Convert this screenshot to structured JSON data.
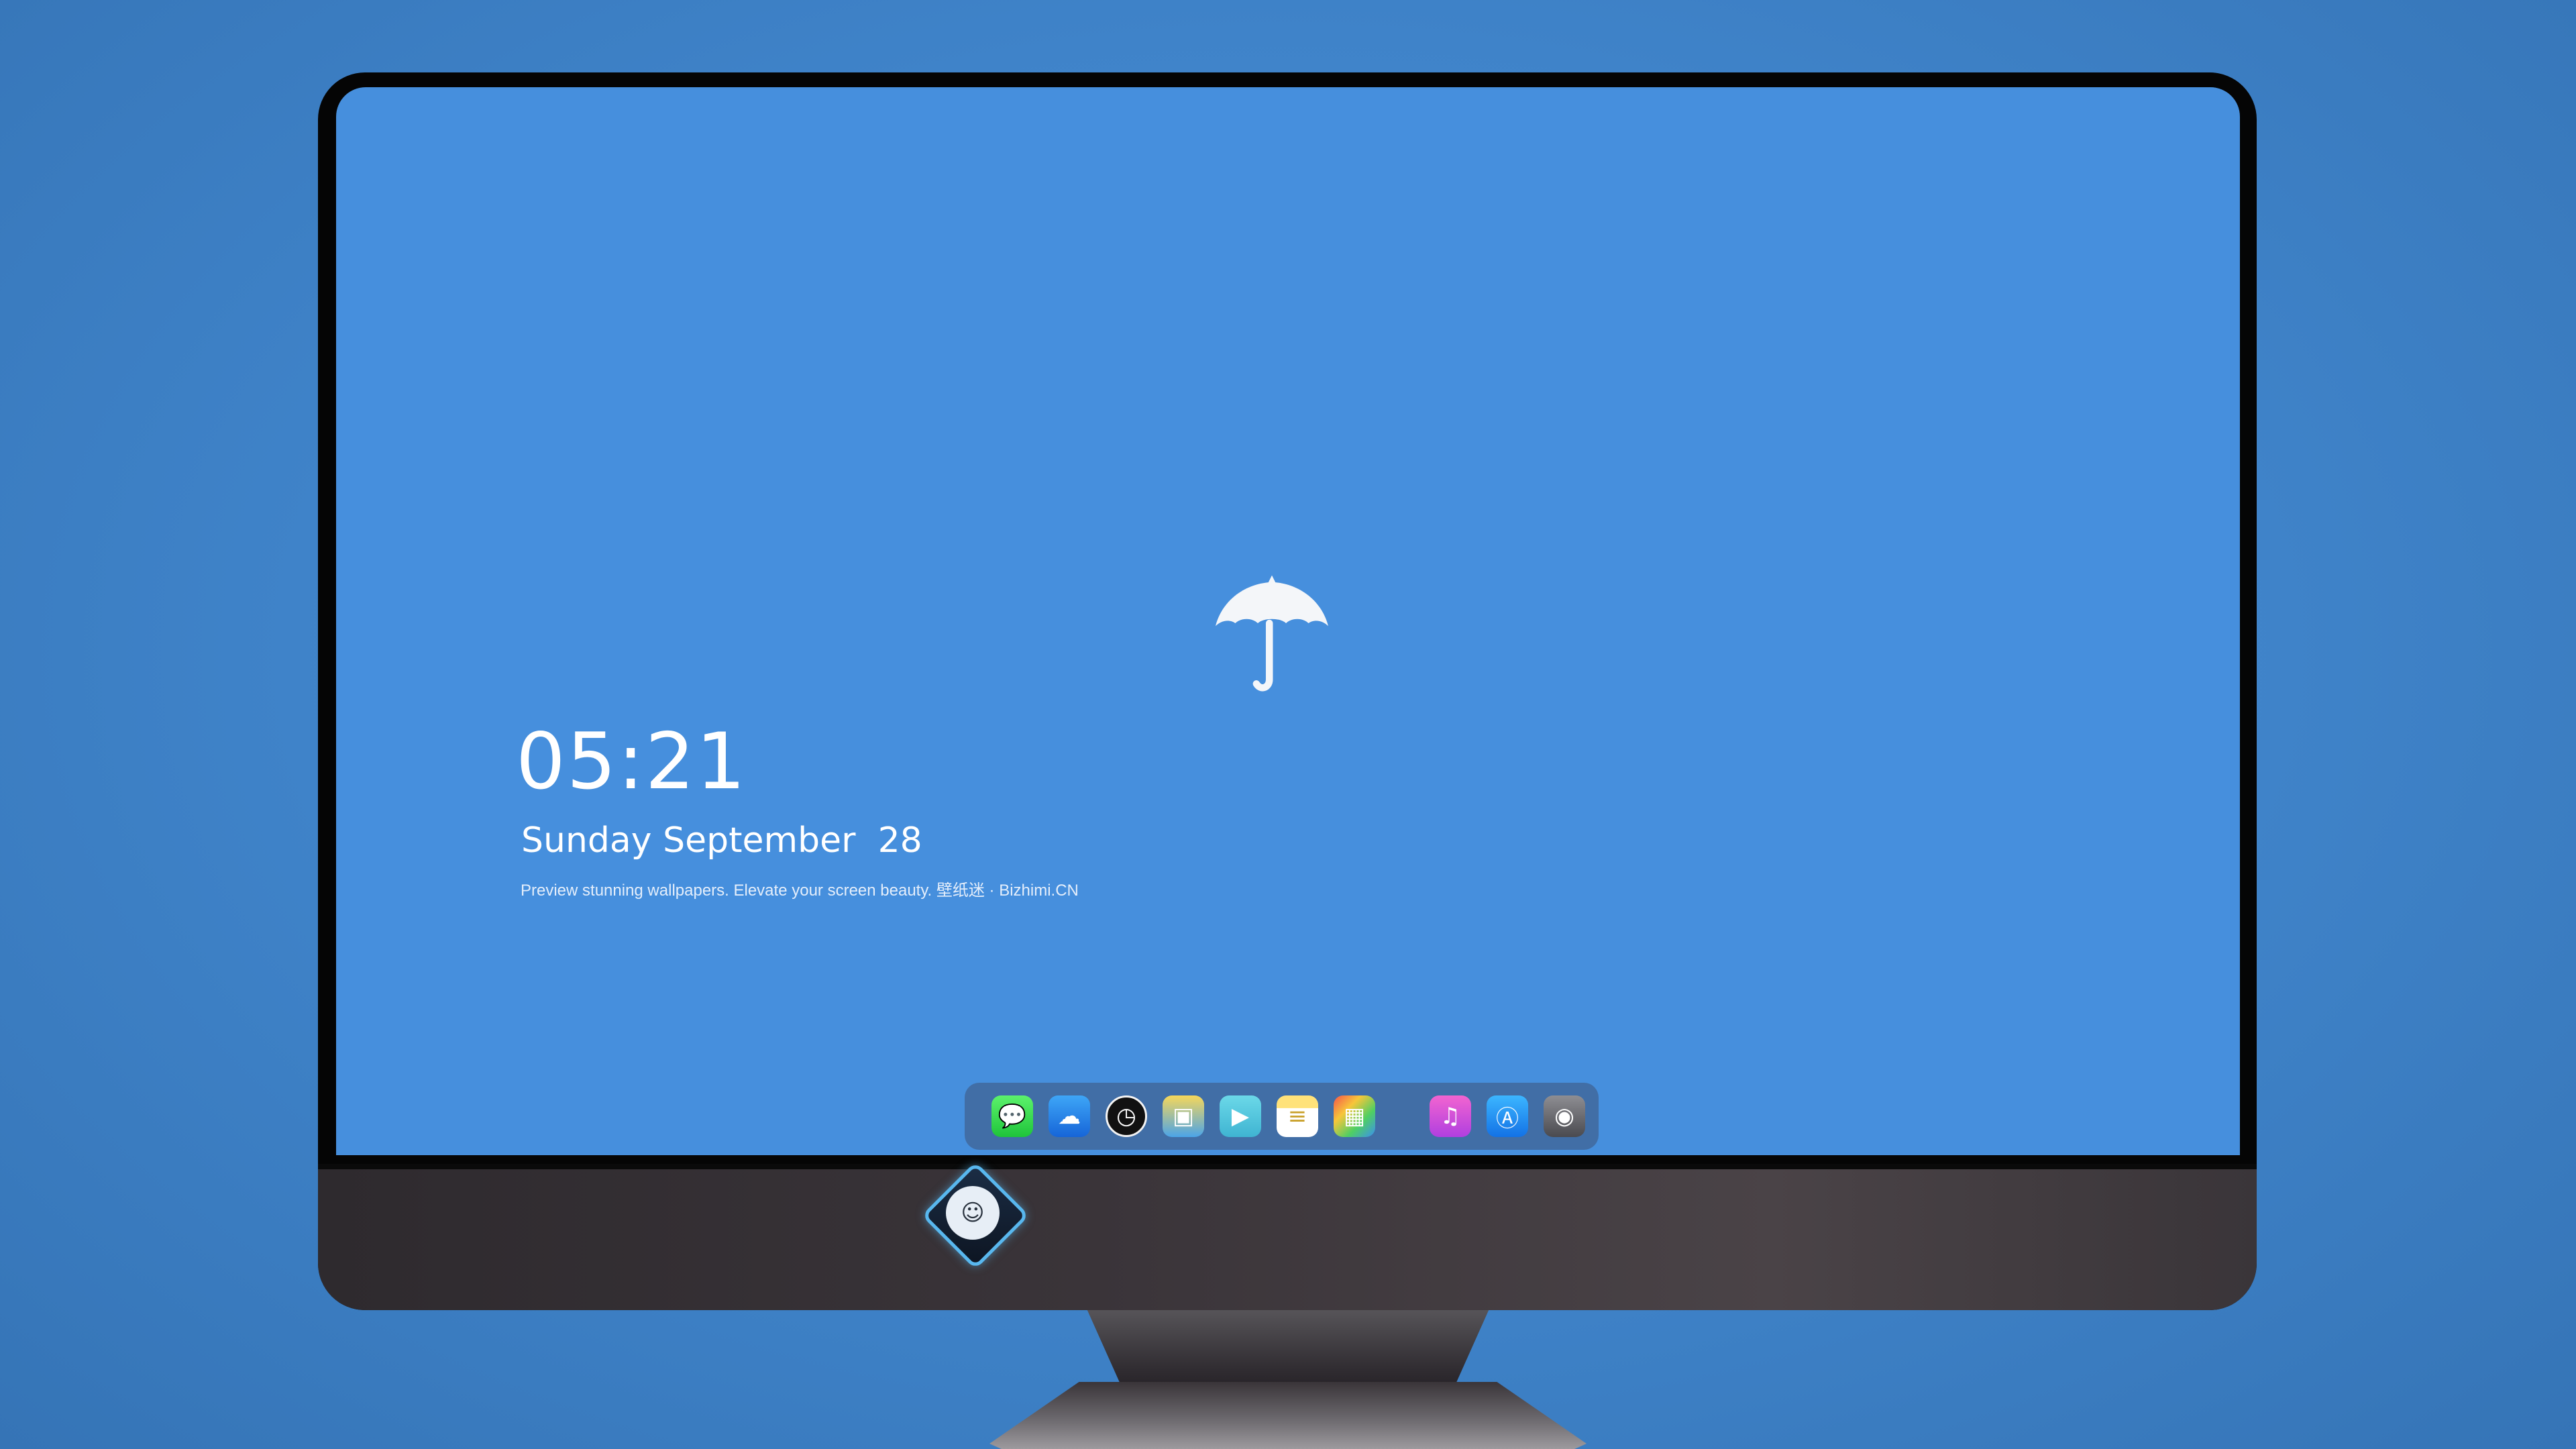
{
  "lockscreen": {
    "time": "05:21",
    "date": "Sunday September  28",
    "tagline": "Preview stunning wallpapers. Elevate your screen beauty. 壁纸迷 · Bizhimi.CN"
  },
  "wallpaper": {
    "background_color": "#468fdd",
    "center_icon": "umbrella-icon"
  },
  "dock": {
    "apps": [
      {
        "name": "messages",
        "icon": "messages-icon",
        "glyph": "💬"
      },
      {
        "name": "weather",
        "icon": "weather-icon",
        "glyph": "☁"
      },
      {
        "name": "clock",
        "icon": "clock-icon",
        "glyph": "◷"
      },
      {
        "name": "preview",
        "icon": "preview-icon",
        "glyph": "▣"
      },
      {
        "name": "clips",
        "icon": "clapperboard-icon",
        "glyph": "▶"
      },
      {
        "name": "notes",
        "icon": "notes-icon",
        "glyph": "≡"
      },
      {
        "name": "photo-booth",
        "icon": "photo-booth-icon",
        "glyph": "▦"
      },
      {
        "name": "music",
        "icon": "music-icon",
        "glyph": "♫"
      },
      {
        "name": "app-store",
        "icon": "app-store-icon",
        "glyph": "Ⓐ"
      },
      {
        "name": "camera",
        "icon": "camera-icon",
        "glyph": "◉"
      }
    ]
  },
  "monitor": {
    "logo": "mascot-logo-icon"
  }
}
